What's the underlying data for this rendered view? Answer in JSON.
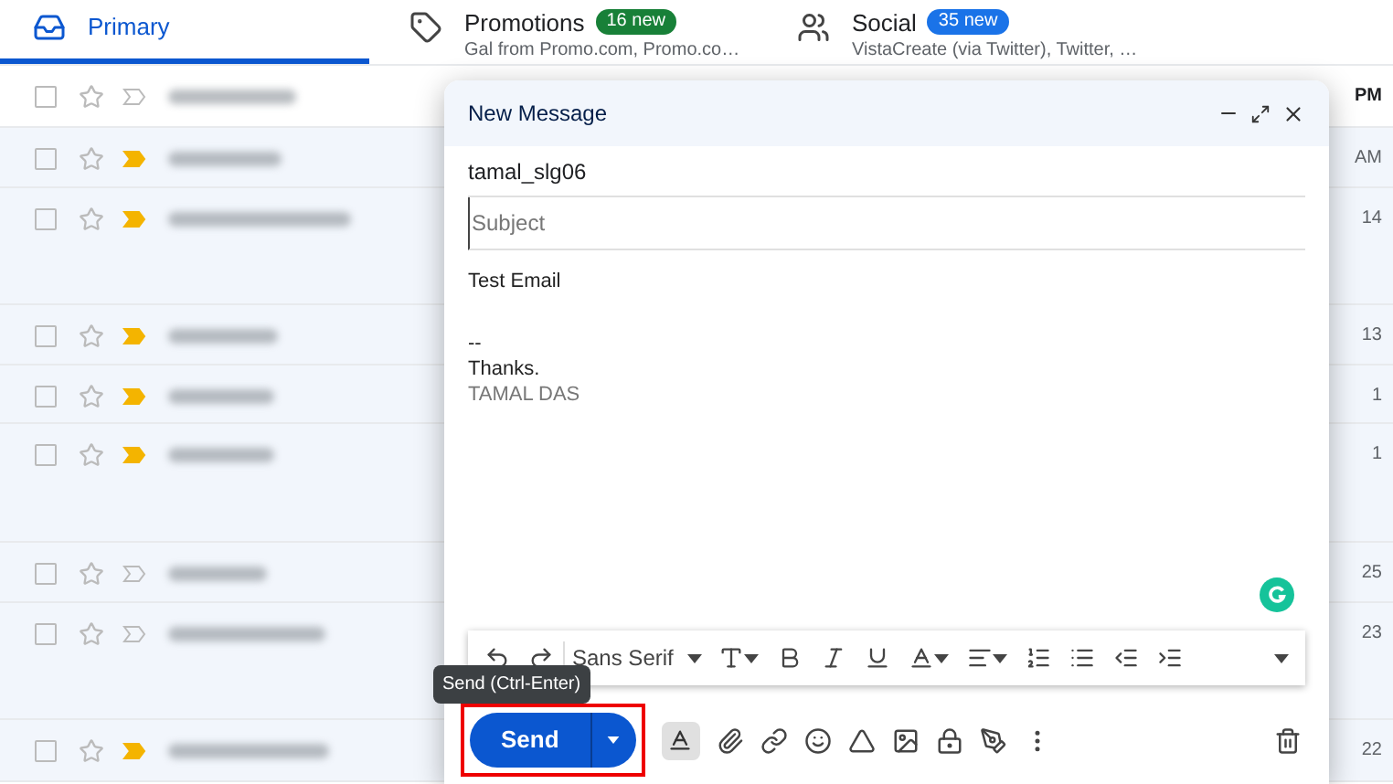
{
  "tabs": [
    {
      "kind": "primary",
      "label": "Primary",
      "selected": true
    },
    {
      "kind": "promotions",
      "label": "Promotions",
      "selected": false,
      "badge": "16 new",
      "color": "#188038",
      "snippet": "Gal from Promo.com, Promo.co…"
    },
    {
      "kind": "social",
      "label": "Social",
      "selected": false,
      "badge": "35 new",
      "color": "#1a73e8",
      "snippet": "VistaCreate (via Twitter), Twitter, …"
    }
  ],
  "rows": [
    {
      "checked": false,
      "unread": true,
      "important": false,
      "time": "PM"
    },
    {
      "checked": false,
      "unread": false,
      "important": true,
      "time": "AM"
    },
    {
      "checked": false,
      "unread": false,
      "important": true,
      "time": "14"
    },
    {
      "checked": false,
      "unread": false,
      "important": true,
      "time": "13"
    },
    {
      "checked": false,
      "unread": false,
      "important": true,
      "time": "1"
    },
    {
      "checked": false,
      "unread": false,
      "important": true,
      "time": "1"
    },
    {
      "checked": false,
      "unread": false,
      "important": false,
      "time": "25"
    },
    {
      "checked": false,
      "unread": false,
      "important": false,
      "time": "23"
    },
    {
      "checked": false,
      "unread": false,
      "important": true,
      "time": "22"
    }
  ],
  "compose": {
    "title": "New Message",
    "to": "tamal_slg06",
    "subject_placeholder": "Subject",
    "body": [
      [
        "Test Email"
      ],
      [
        "--",
        "Thanks."
      ]
    ],
    "signature_name": "TAMAL DAS",
    "font": "Sans Serif",
    "send": "Send",
    "tooltip": "Send (Ctrl-Enter)",
    "formatting_on": true
  }
}
